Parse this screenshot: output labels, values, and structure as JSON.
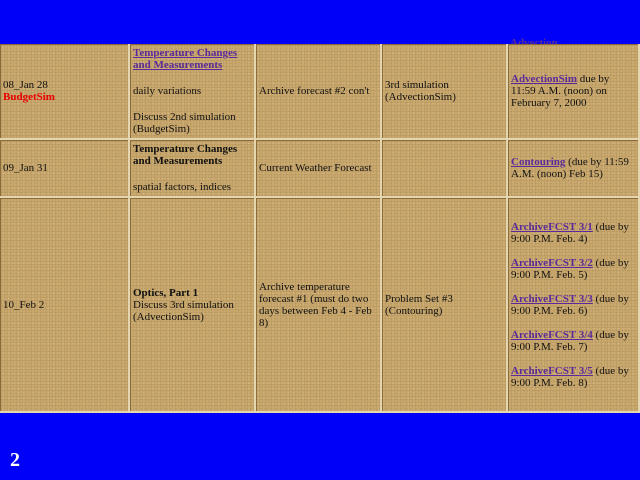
{
  "top_fragment": "Advection...",
  "rows": [
    {
      "session": "08_Jan 28",
      "session_alert": "BudgetSim",
      "topic": "Temperature Changes and Measurements",
      "topic_detail_1": "daily variations",
      "topic_detail_2": "Discuss 2nd simulation (BudgetSim)",
      "forecast": "Archive forecast #2 con't",
      "assignment": "3rd simulation (AdvectionSim)",
      "due_link": "AdvectionSim",
      "due_text": " due by 11:59 A.M. (noon) on February 7, 2000"
    },
    {
      "session": "09_Jan 31",
      "topic": "Temperature Changes and Measurements",
      "topic_detail_1": "spatial factors, indices",
      "forecast": "Current Weather Forecast",
      "assignment": "",
      "due_link": "Contouring",
      "due_text": " (due by 11:59 A.M. (noon) Feb 15)"
    },
    {
      "session": "10_Feb 2",
      "topic": "Optics, Part 1",
      "topic_detail_1": "Discuss 3rd simulation (AdvectionSim)",
      "forecast": "Archive temperature forecast #1 (must do two days between Feb 4 - Feb 8)",
      "assignment": "Problem Set #3 (Contouring)",
      "due_items": [
        {
          "link": "ArchiveFCST 3/1",
          "text": " (due by 9:00 P.M. Feb. 4)"
        },
        {
          "link": "ArchiveFCST 3/2",
          "text": " (due by 9:00 P.M. Feb. 5)"
        },
        {
          "link": "ArchiveFCST 3/3",
          "text": " (due by 9:00 P.M. Feb. 6)"
        },
        {
          "link": "ArchiveFCST 3/4",
          "text": " (due by 9:00 P.M. Feb. 7)"
        },
        {
          "link": "ArchiveFCST 3/5",
          "text": " (due by 9:00 P.M. Feb. 8)"
        }
      ]
    }
  ],
  "page_number": "2",
  "colors": {
    "background": "#0000f8",
    "parchment": "#c9a86e",
    "link": "#5a2a9a",
    "alert": "#e80000"
  }
}
